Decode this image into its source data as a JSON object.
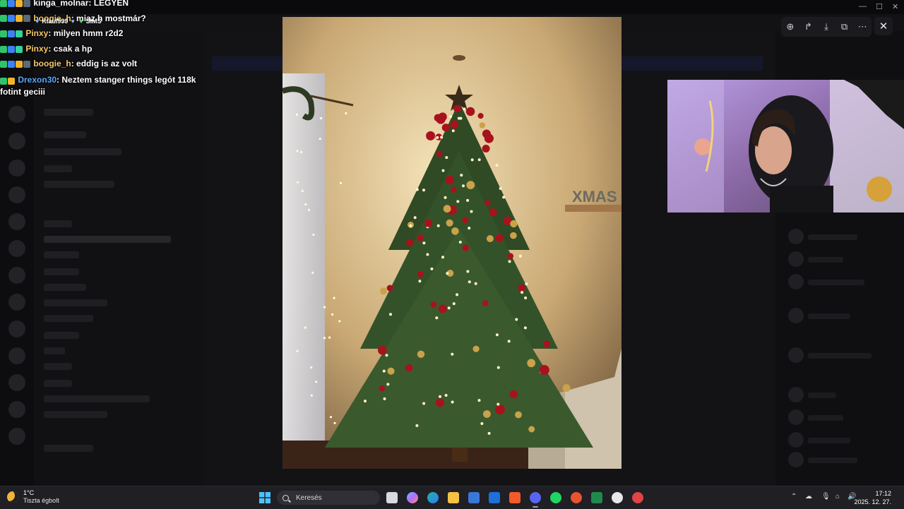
{
  "chat": {
    "messages": [
      {
        "user": "kinga_molnar",
        "sep": ":",
        "text": "LEGYEN",
        "user_color": "#f5f5f5"
      },
      {
        "user": "boogie_h",
        "sep": ":",
        "text": "miaz h mostmár?",
        "user_color": "#f7c86a"
      },
      {
        "user": "Pinxy",
        "sep": ":",
        "text": "milyen hmm r2d2",
        "user_color": "#f7c86a"
      },
      {
        "user": "Pinxy",
        "sep": ":",
        "text": "csak a hp",
        "user_color": "#f7c86a"
      },
      {
        "user": "boogie_h",
        "sep": ":",
        "text": "eddig is az volt",
        "user_color": "#f7c86a"
      },
      {
        "user": "Drexon30",
        "sep": ":",
        "text": "Neztem stanger things legót 118k fotint geciii",
        "user_color": "#5aa9ff"
      }
    ],
    "overlay": {
      "name": "Klaul999",
      "tag": "SIMS"
    }
  },
  "viewer": {
    "sign_text": "XMAS",
    "tools": [
      {
        "name": "zoom-icon",
        "glyph": "⊕"
      },
      {
        "name": "forward-icon",
        "glyph": "↱"
      },
      {
        "name": "download-icon",
        "glyph": "⤓"
      },
      {
        "name": "open-external-icon",
        "glyph": "⧉"
      },
      {
        "name": "more-icon",
        "glyph": "⋯"
      }
    ],
    "close_glyph": "✕"
  },
  "window_controls": {
    "minimize": "—",
    "maximize": "☐",
    "close": "✕"
  },
  "taskbar": {
    "weather_temp": "1°C",
    "weather_desc": "Tiszta égbolt",
    "search_placeholder": "Keresés",
    "clock_time": "17:12",
    "clock_date": "2025. 12. 27."
  },
  "colors": {
    "discord_accent": "#5865f2",
    "taskbar_bg": "#1f1f24",
    "chat_text": "#ffffff"
  }
}
